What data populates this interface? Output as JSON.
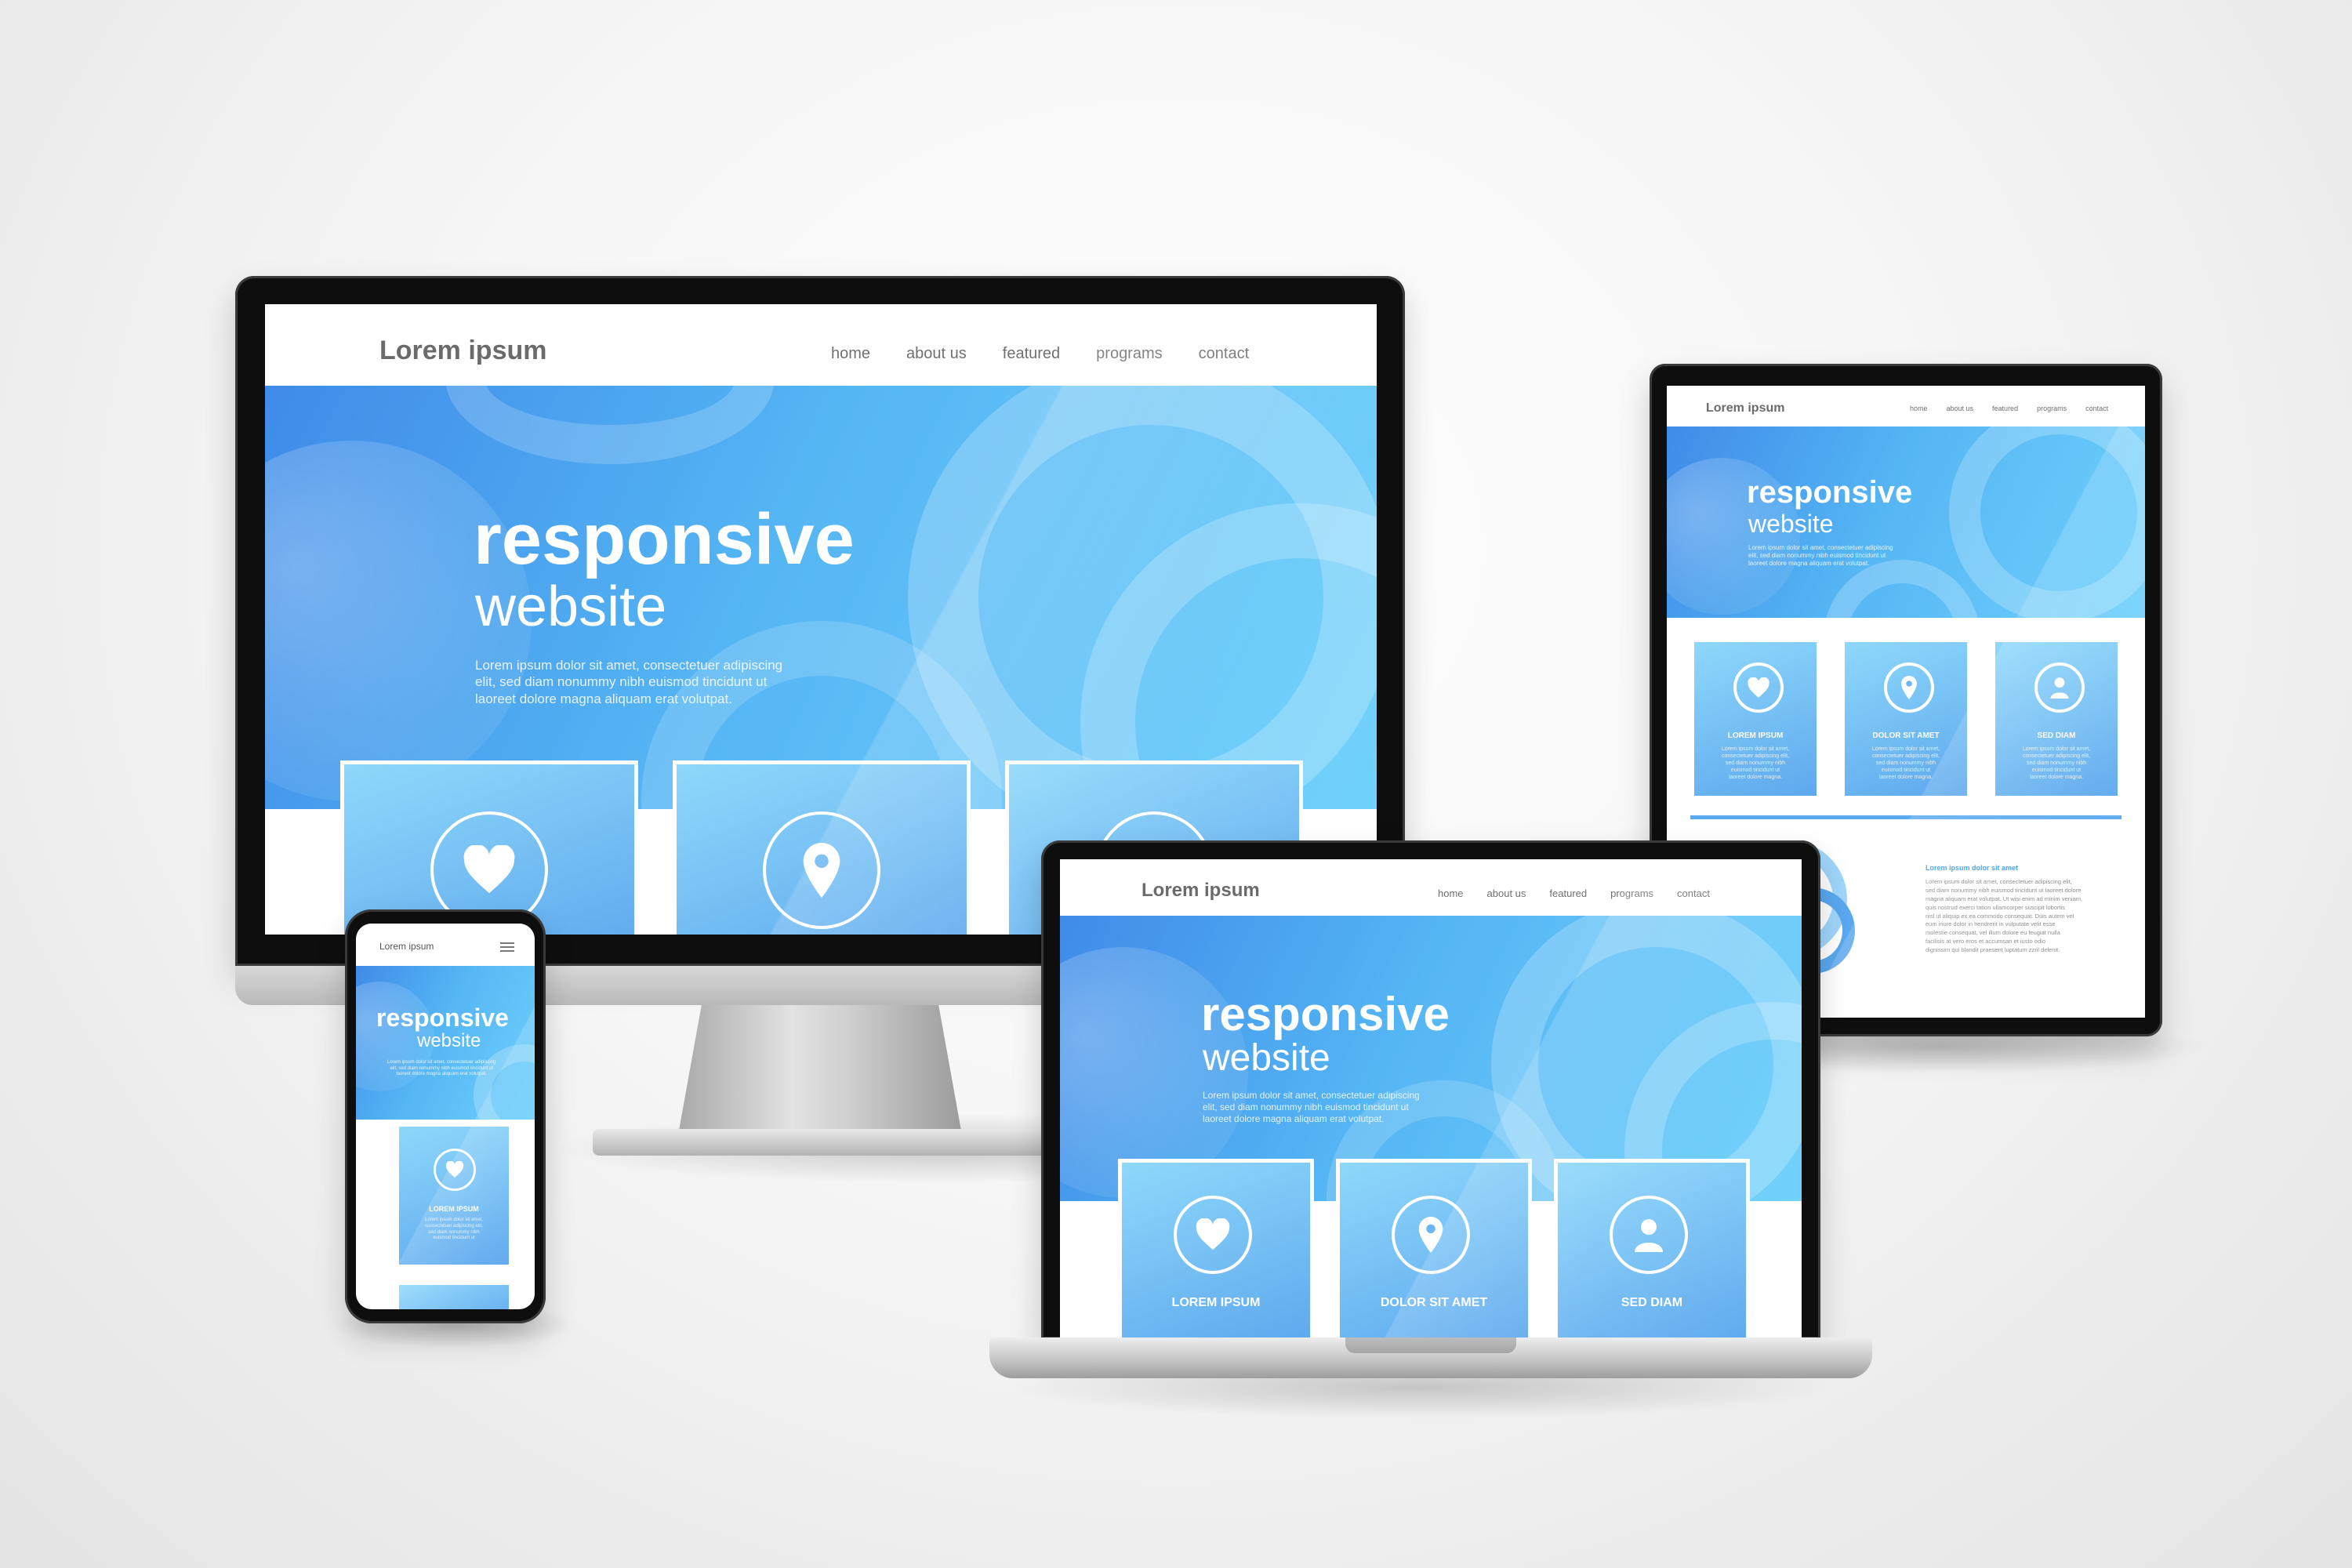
{
  "site": {
    "logo": "Lorem ipsum",
    "nav": [
      "home",
      "about us",
      "featured",
      "programs",
      "contact"
    ],
    "hero_title": "responsive",
    "hero_subtitle": "website",
    "hero_text_lines": [
      "Lorem ipsum dolor sit amet, consectetuer adipiscing",
      "elit, sed diam nonummy nibh euismod tincidunt ut",
      "laoreet dolore magna aliquam erat volutpat."
    ],
    "cards": [
      {
        "title": "LOREM IPSUM",
        "icon": "heart-icon"
      },
      {
        "title": "DOLOR SIT AMET",
        "icon": "location-pin-icon"
      },
      {
        "title": "SED DIAM",
        "icon": "user-icon"
      }
    ],
    "card_text_lines": [
      "Lorem ipsum dolor sit amet,",
      "consectetuer adipiscing elit,",
      "sed diam nonummy nibh",
      "euismod tincidunt ut",
      "laoreet dolore magna."
    ],
    "section_title": "Lorem ipsum dolor sit amet",
    "section_text_lines": [
      "Lorem ipsum dolor sit amet, consectetuer adipiscing elit,",
      "sed diam nonummy nibh euismod tincidunt ut laoreet dolore",
      "magna aliquam erat volutpat. Ut wisi enim ad minim veniam,",
      "quis nostrud exerci tation ullamcorper suscipit lobortis",
      "nisl ut aliquip ex ea commodo consequat. Duis autem vel",
      "eum iriure dolor in hendrerit in vulputate velit esse",
      "molestie consequat, vel illum dolore eu feugiat nulla",
      "facilisis at vero eros et accumsan et iusto odio",
      "dignissim qui blandit praesent luptatum zzril delenit."
    ]
  },
  "colors": {
    "hero_start": "#3f8be8",
    "hero_end": "#6fd1fb",
    "card_top": "#8ed8fb",
    "card_bottom": "#5ea8ee",
    "accent": "#3c9cf0",
    "bezel": "#0e0e0e"
  }
}
